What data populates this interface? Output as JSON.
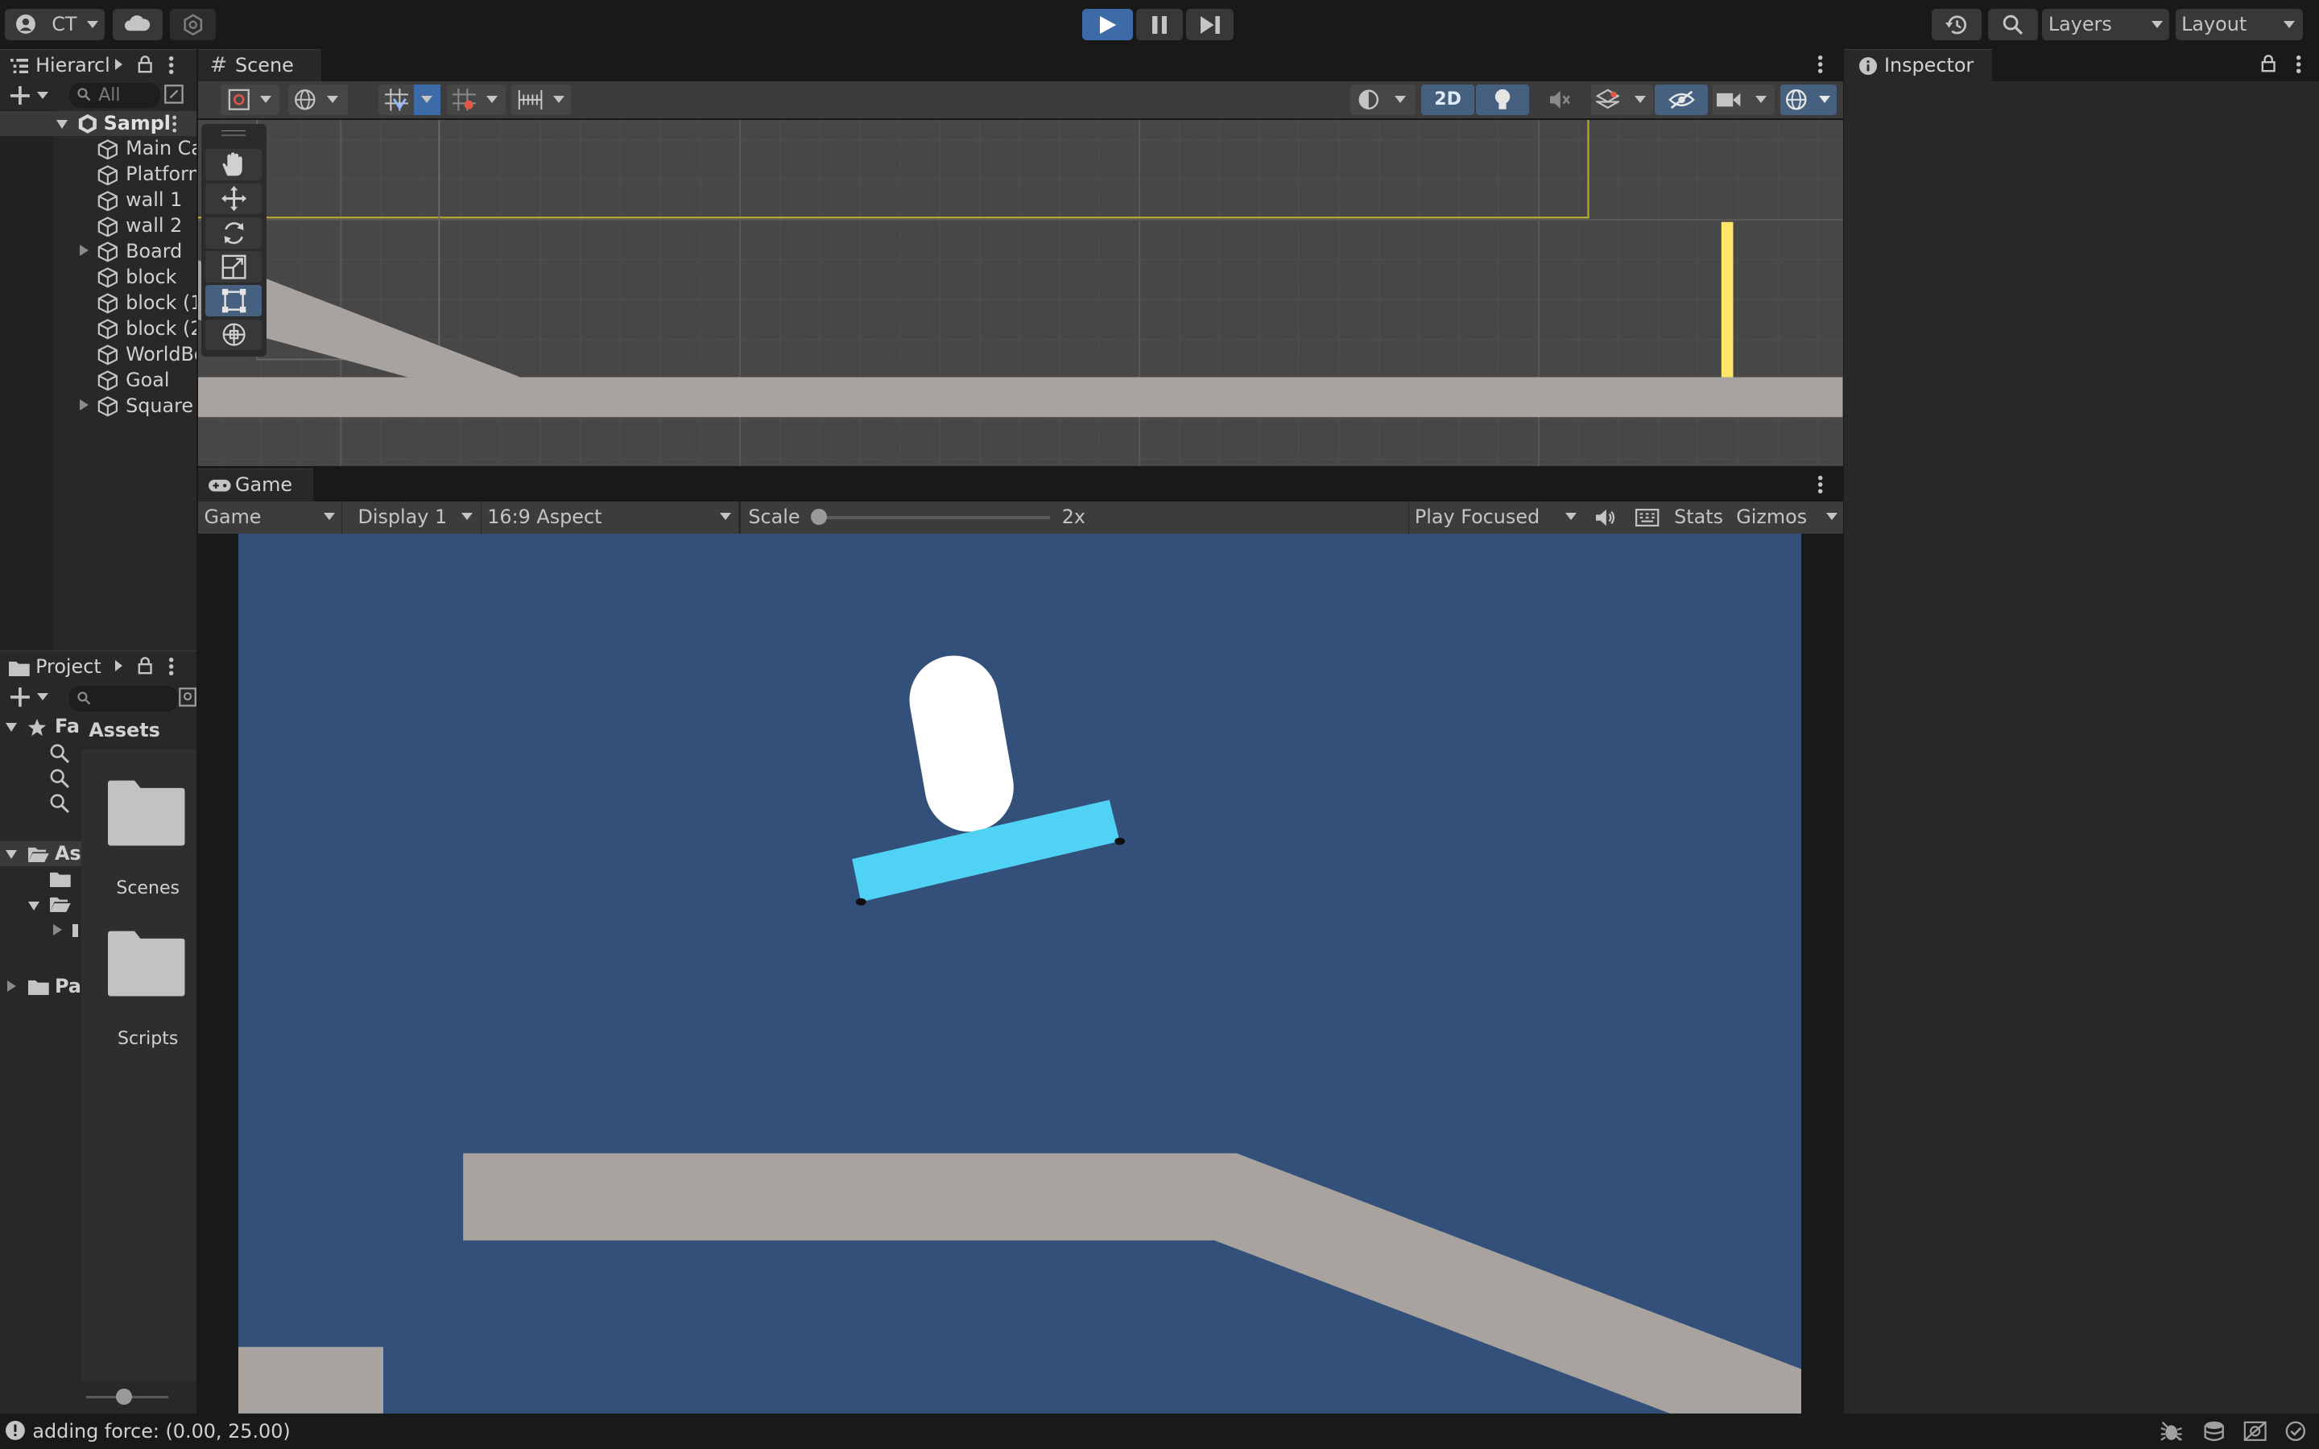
{
  "toolbar": {
    "account_label": "CT",
    "layers_label": "Layers",
    "layout_label": "Layout"
  },
  "hierarchy": {
    "tab_label": "Hierarcl",
    "search_placeholder": "All",
    "scene_name": "Sampl",
    "items": [
      {
        "label": "Main Ca"
      },
      {
        "label": "Platform"
      },
      {
        "label": "wall 1"
      },
      {
        "label": "wall 2"
      },
      {
        "label": "Board"
      },
      {
        "label": "block"
      },
      {
        "label": "block (1"
      },
      {
        "label": "block (2"
      },
      {
        "label": "WorldBo"
      },
      {
        "label": "Goal"
      },
      {
        "label": "Square"
      }
    ]
  },
  "scene": {
    "tab_label": "Scene",
    "mode_2d_label": "2D"
  },
  "game": {
    "tab_label": "Game",
    "view_select": "Game",
    "display_select": "Display 1",
    "aspect_select": "16:9 Aspect",
    "scale_label": "Scale",
    "scale_value": "2x",
    "scale_fraction": 0.0,
    "play_mode_select": "Play Focused",
    "stats_label": "Stats",
    "gizmos_label": "Gizmos"
  },
  "project": {
    "tab_label": "Project",
    "assets_header": "Assets",
    "tree": [
      {
        "label": "Fa"
      },
      {
        "label": "As"
      },
      {
        "label": "Pa"
      }
    ],
    "folders": [
      {
        "label": "Scenes"
      },
      {
        "label": "Scripts"
      }
    ],
    "icon_size_fraction": 0.45
  },
  "inspector": {
    "tab_label": "Inspector"
  },
  "status": {
    "message": "adding force: (0.00, 25.00)"
  },
  "colors": {
    "accent_blue": "#3d6ba8",
    "game_background": "#33507a",
    "platform": "#a8a39e",
    "board": "#4fd2f4",
    "player": "#ffffff",
    "goal": "#ffe56a"
  }
}
